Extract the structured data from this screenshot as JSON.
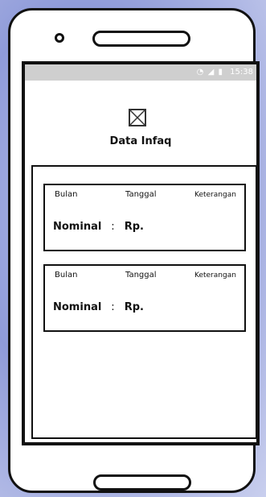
{
  "status": {
    "icons": "wifi-icon, signal-icon, battery-icon",
    "time": "15:38"
  },
  "header": {
    "image": "image-placeholder",
    "title": "Data Infaq"
  },
  "cards": [
    {
      "bulan_label": "Bulan",
      "tanggal_label": "Tanggal",
      "keterangan_label": "Keterangan",
      "nominal_label": "Nominal",
      "separator": ":",
      "currency": "Rp."
    },
    {
      "bulan_label": "Bulan",
      "tanggal_label": "Tanggal",
      "keterangan_label": "Keterangan",
      "nominal_label": "Nominal",
      "separator": ":",
      "currency": "Rp."
    }
  ]
}
